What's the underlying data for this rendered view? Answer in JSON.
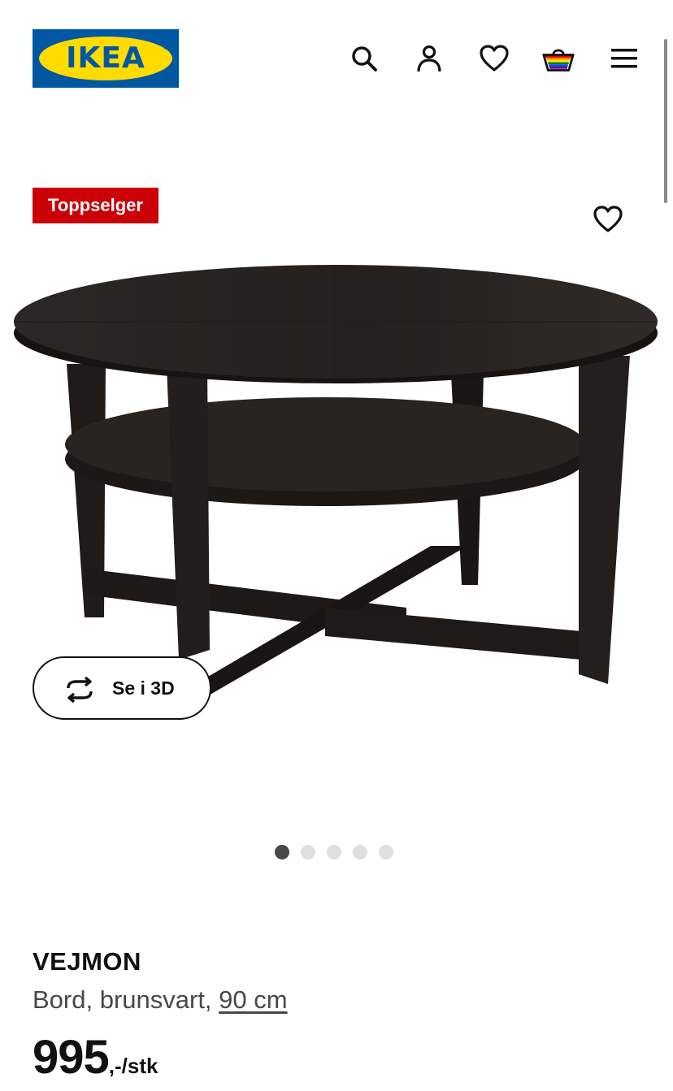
{
  "header": {
    "logo_text": "IKEA",
    "logo_colors": {
      "blue": "#0058a3",
      "yellow": "#ffdb00"
    },
    "icons": [
      "search-icon",
      "user-icon",
      "heart-icon",
      "basket-icon",
      "menu-icon"
    ]
  },
  "product": {
    "badge": "Toppselger",
    "badge_color": "#cc0008",
    "favorite_icon": "heart-icon",
    "view_3d_label": "Se i 3D",
    "view_3d_icon": "rotate-arrows-icon",
    "carousel": {
      "total": 5,
      "active": 1
    },
    "name": "VEJMON",
    "desc_prefix": "Bord, brunsvart, ",
    "size": "90 cm",
    "price_int": "995",
    "price_suffix": ",-/stk"
  }
}
